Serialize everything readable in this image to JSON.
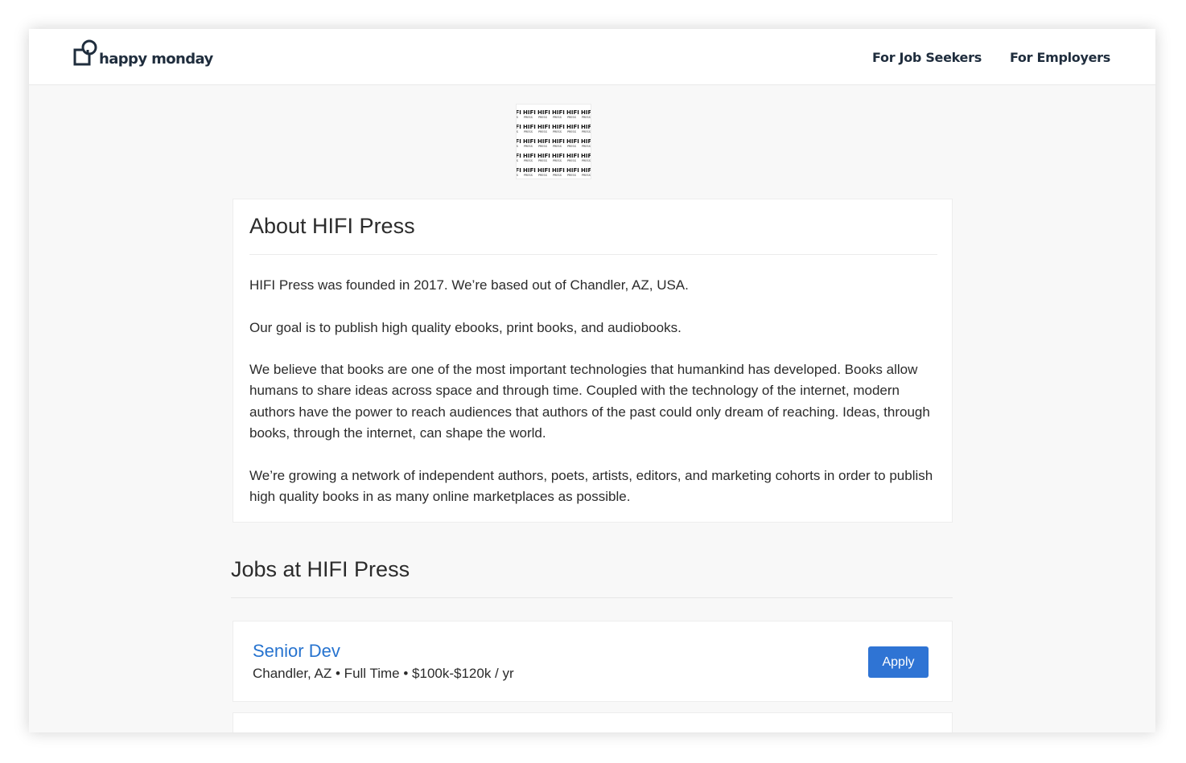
{
  "header": {
    "logo_text": "happy monday",
    "nav": [
      {
        "label": "For Job Seekers"
      },
      {
        "label": "For Employers"
      }
    ]
  },
  "company": {
    "logo_text": "HIFI PRESS"
  },
  "about": {
    "title": "About HIFI Press",
    "paragraphs": [
      "HIFI Press was founded in 2017. We’re based out of Chandler, AZ, USA.",
      "Our goal is to publish high quality ebooks, print books, and audiobooks.",
      "We believe that books are one of the most important technologies that humankind has developed. Books allow humans to share ideas across space and through time. Coupled with the technology of the internet, modern authors have the power to reach audiences that authors of the past could only dream of reaching. Ideas, through books, through the internet, can shape the world.",
      "We’re growing a network of independent authors, poets, artists, editors, and marketing cohorts in order to publish high quality books in as many online marketplaces as possible."
    ]
  },
  "jobs": {
    "title": "Jobs at HIFI Press",
    "items": [
      {
        "title": "Senior Dev",
        "meta": "Chandler, AZ • Full Time • $100k-$120k / yr",
        "apply_label": "Apply"
      }
    ]
  },
  "colors": {
    "link": "#2673cf",
    "button": "#2f74d4",
    "nav_text": "#1f2d3d",
    "background": "#f8f8f8"
  }
}
